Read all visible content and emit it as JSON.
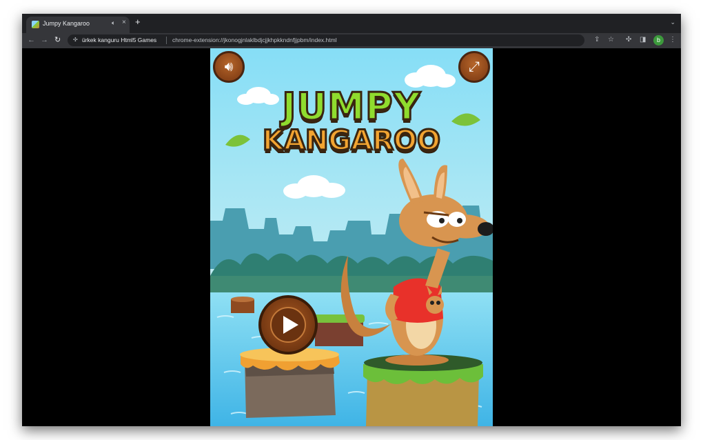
{
  "tab": {
    "title": "Jumpy Kangaroo",
    "audio_icon": "speaker-icon",
    "close_label": "×"
  },
  "newtab_label": "+",
  "tabsearch_label": "⌄",
  "toolbar": {
    "back_label": "←",
    "forward_label": "→",
    "reload_label": "↻",
    "site_name": "ürkek kanguru Html5 Games",
    "url": "chrome-extension://jkonogjnlaklbdjcjjkhpkkndnfjjpbm/index.html",
    "share_label": "⇪",
    "bookmark_label": "☆",
    "extensions_label": "✣",
    "sidepanel_label": "◨",
    "profile_initial": "b",
    "menu_label": "⋮"
  },
  "game": {
    "title_line1": "JUMPY",
    "title_line2": "KANGAROO",
    "sound_button_icon": "speaker-icon",
    "fullscreen_button_icon": "expand-icon",
    "play_button_icon": "play-icon"
  },
  "colors": {
    "sky": "#8ee0f5",
    "title_green": "#8fdc2e",
    "title_orange": "#f2a431",
    "kangaroo": "#d89550",
    "shirt": "#e8312a",
    "water": "#5ec8ee"
  }
}
